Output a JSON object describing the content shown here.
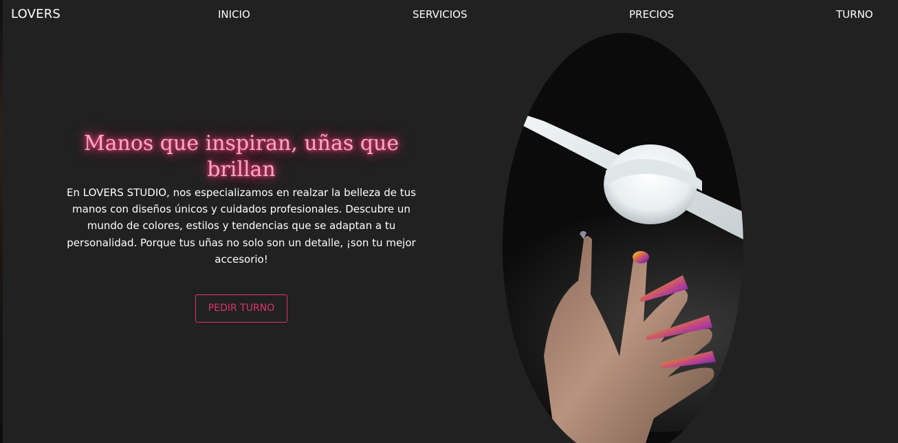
{
  "nav": {
    "logo": "LOVERS",
    "links": [
      "INICIO",
      "SERVICIOS",
      "PRECIOS",
      "TURNO"
    ]
  },
  "hero": {
    "title": "Manos que inspiran, uñas que brillan",
    "description": "En LOVERS STUDIO, nos especializamos en realzar la belleza de tus manos con diseños únicos y cuidados profesionales. Descubre un mundo de colores, estilos y tendencias que se adaptan a tu personalidad. Porque tus uñas no solo son un detalle, ¡son tu mejor accesorio!",
    "cta_label": "PEDIR TURNO"
  },
  "colors": {
    "background": "#212121",
    "accent_pink": "#e0356c",
    "title_pink": "#f7a9c6",
    "text": "#ffffff"
  },
  "icons": {
    "photo": "manicured-hand-with-lamp-photo"
  }
}
